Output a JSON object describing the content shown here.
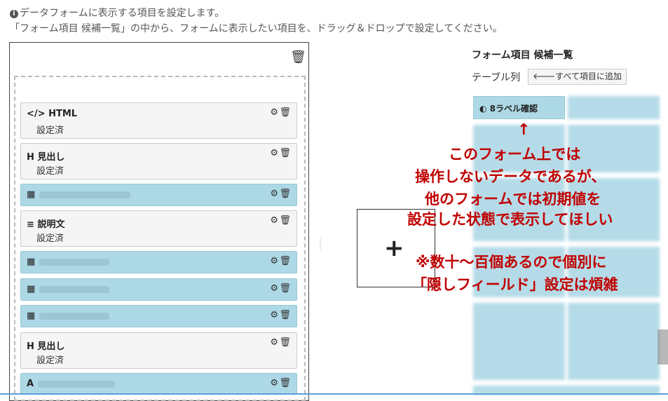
{
  "info": {
    "line1": "データフォームに表示する項目を設定します。",
    "line2": "「フォーム項目 候補一覧」の中から、フォームに表示したい項目を、ドラッグ＆ドロップで設定してください。"
  },
  "form_items": [
    {
      "icon": "</>",
      "title": "HTML",
      "sub": "設定済",
      "style": "plain"
    },
    {
      "icon": "H",
      "title": "見出し",
      "sub": "設定済",
      "style": "plain"
    },
    {
      "icon": "▦",
      "title": "",
      "sub": "",
      "style": "blue"
    },
    {
      "icon": "≡",
      "title": "説明文",
      "sub": "設定済",
      "style": "plain"
    },
    {
      "icon": "▦",
      "title": "",
      "sub": "",
      "style": "blue"
    },
    {
      "icon": "▦",
      "title": "",
      "sub": "",
      "style": "blue"
    },
    {
      "icon": "▦",
      "title": "",
      "sub": "",
      "style": "blue"
    },
    {
      "icon": "H",
      "title": "見出し",
      "sub": "設定済",
      "style": "plain"
    },
    {
      "icon": "A",
      "title": "",
      "sub": "",
      "style": "blue"
    }
  ],
  "candidates": {
    "title": "フォーム項目 候補一覧",
    "table_label": "テーブル列",
    "add_all_button": "🡐すべて項目に追加",
    "confirm_item": "◐ 8ラベル確認"
  },
  "annotation": {
    "lines": [
      "このフォーム上では",
      "操作しないデータであるが、",
      "他のフォームでは初期値を",
      "設定した状態で表示してほしい",
      "※数十〜百個あるので個別に",
      "「隠しフィールド」設定は煩雑"
    ],
    "arrow": "↑"
  },
  "colors": {
    "accent_blue": "#add8e6",
    "annotation_red": "#c00000"
  }
}
